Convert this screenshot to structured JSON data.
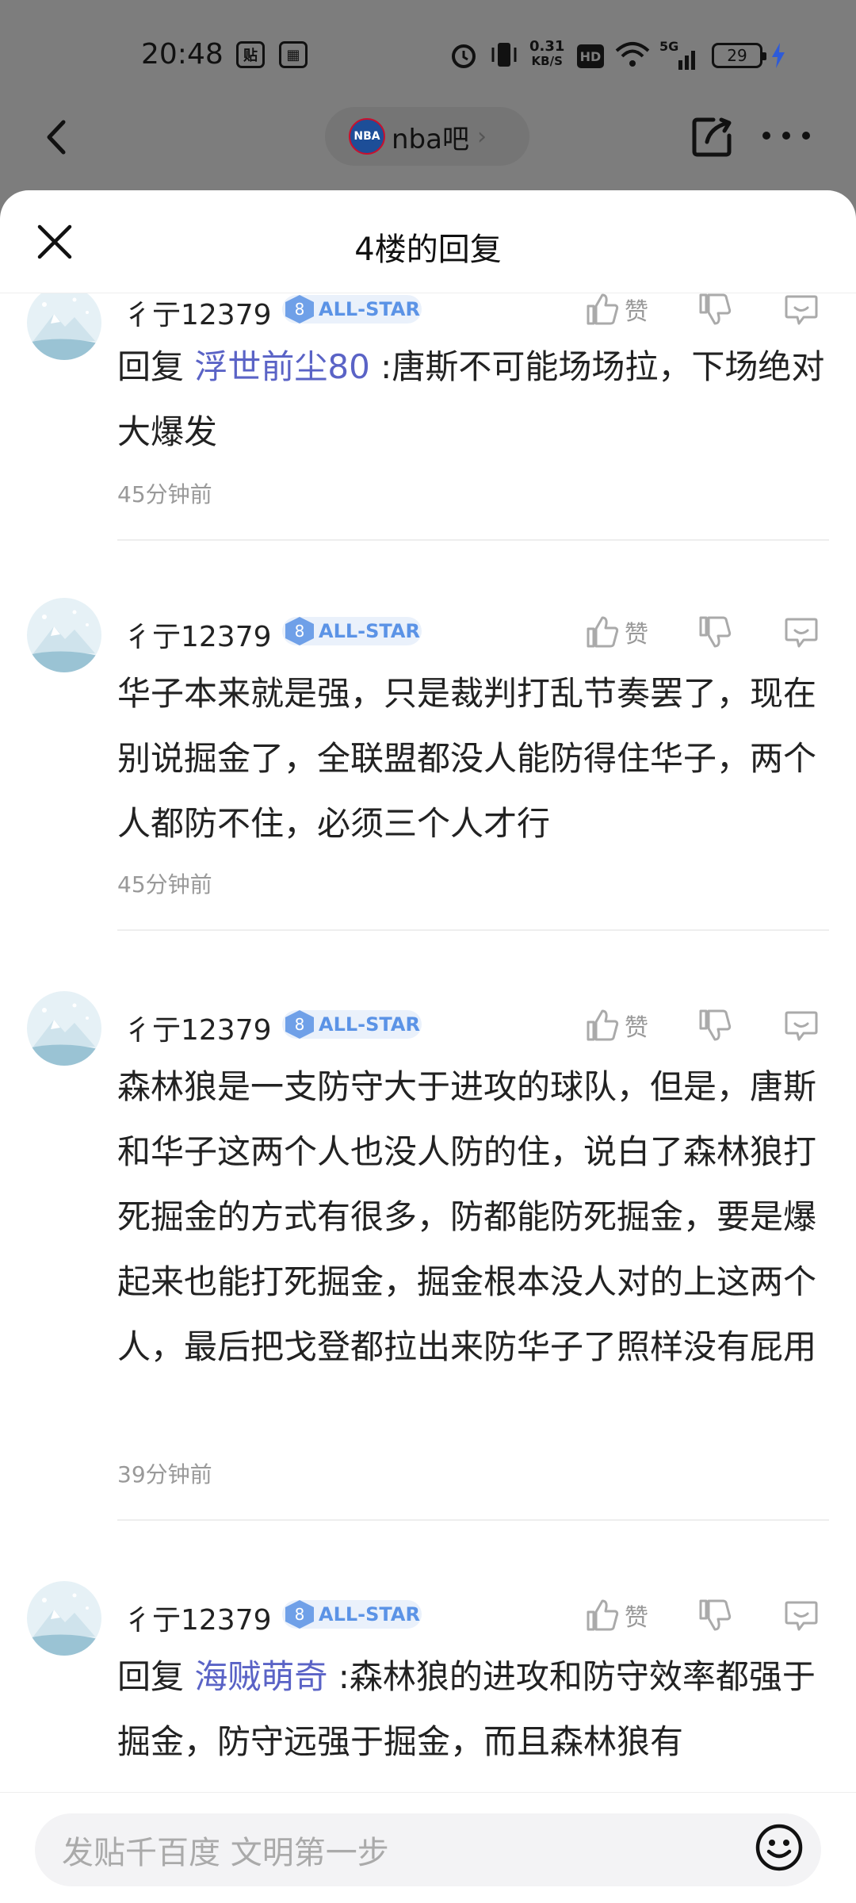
{
  "status_bar": {
    "time": "20:48",
    "icon_badge_1": "贴",
    "net_speed_value": "0.31",
    "net_speed_unit": "KB/S",
    "hd": "HD",
    "network": "5G",
    "battery": "29"
  },
  "nav": {
    "forum_logo_text": "NBA",
    "forum_name": "nba吧"
  },
  "sheet": {
    "title": "4楼的回复"
  },
  "replies": [
    {
      "username": "彳亍12379",
      "level": "8",
      "badge": "ALL-STAR",
      "like_label": "赞",
      "reply_prefix": "回复 ",
      "mention": "浮世前尘80",
      "text_after_mention": " :唐斯不可能场场拉，下场绝对大爆发",
      "time": "45分钟前"
    },
    {
      "username": "彳亍12379",
      "level": "8",
      "badge": "ALL-STAR",
      "like_label": "赞",
      "text": "华子本来就是强，只是裁判打乱节奏罢了，现在别说掘金了，全联盟都没人能防得住华子，两个人都防不住，必须三个人才行",
      "time": "45分钟前"
    },
    {
      "username": "彳亍12379",
      "level": "8",
      "badge": "ALL-STAR",
      "like_label": "赞",
      "text": "森林狼是一支防守大于进攻的球队，但是，唐斯和华子这两个人也没人防的住，说白了森林狼打死掘金的方式有很多，防都能防死掘金，要是爆起来也能打死掘金，掘金根本没人对的上这两个人，最后把戈登都拉出来防华子了照样没有屁用",
      "time": "39分钟前"
    },
    {
      "username": "彳亍12379",
      "level": "8",
      "badge": "ALL-STAR",
      "like_label": "赞",
      "reply_prefix": "回复 ",
      "mention": "海贼萌奇",
      "text_after_mention": " :森林狼的进攻和防守效率都强于掘金，防守远强于掘金，而且森林狼有"
    }
  ],
  "input_bar": {
    "placeholder": "发贴千百度 文明第一步"
  }
}
